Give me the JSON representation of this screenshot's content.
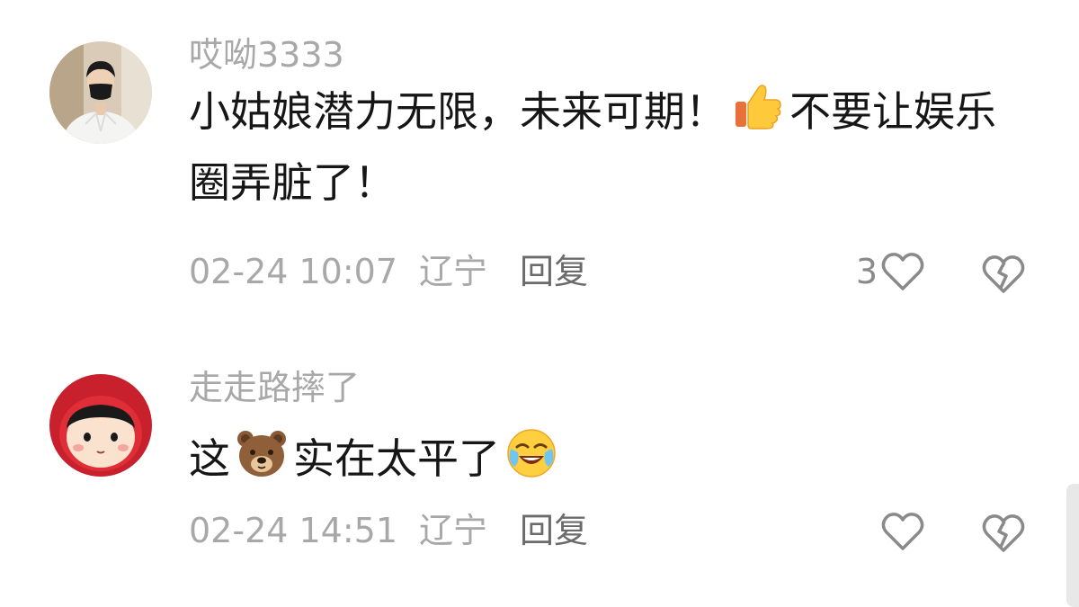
{
  "comments": [
    {
      "username": "哎呦3333",
      "text_part1": "小姑娘潜力无限，未来可期！",
      "text_part2": "不要让娱乐圈弄脏了！",
      "emoji_icon": "thumbs-up-icon",
      "timestamp": "02-24 10:07",
      "location": "辽宁",
      "reply_label": "回复",
      "like_count": "3"
    },
    {
      "username": "走走路摔了",
      "text_part1": "这",
      "text_part2": "实在太平了",
      "emoji_icon": "bear-face-icon",
      "emoji_icon_2": "crying-laughing-icon",
      "timestamp": "02-24 14:51",
      "location": "辽宁",
      "reply_label": "回复",
      "like_count": ""
    }
  ],
  "colors": {
    "secondary_text": "#a8a8a8",
    "primary_text": "#161616",
    "reply": "#6b6b6b",
    "icon_stroke": "#8a8a8a"
  }
}
